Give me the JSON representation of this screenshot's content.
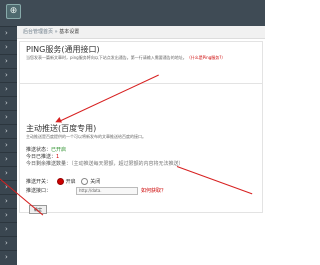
{
  "app": {
    "logo_glyph": "⊕"
  },
  "breadcrumb": {
    "parts": [
      "后台管理首页",
      "基本设置"
    ],
    "sep": " » "
  },
  "ping": {
    "title": "PING服务(通用接口)",
    "desc": "当您发表一篇新文章时，ping服务将向以下站点发出通告。第一行请输入需要通告的地址。",
    "link": "（什么是Ping服务?）"
  },
  "push": {
    "title": "主动推送(百度专用)",
    "desc": "主动推送是百度提供的一个可以将新发布的文章推送给百度的接口。",
    "status_label": "推送状态：",
    "status_value": "已开启",
    "today_label": "今日已推送：",
    "today_value": "1",
    "remaining_label": "今日剩余推送数量：",
    "remaining_desc": "（主动推送每天限额，超过限额的内容将无法推送）",
    "switch_label": "推送开关：",
    "switch_on": "开启",
    "switch_off": "关闭",
    "api_label": "推送接口：",
    "api_value": "http://data.",
    "api_hint": "如何获取？",
    "confirm": "确定"
  },
  "sidebar": {
    "count": 17,
    "arrow_glyph": "›"
  },
  "colors": {
    "accent": "#d72020",
    "nav_bg": "#3a4650",
    "top_bg": "#3f4b55"
  }
}
